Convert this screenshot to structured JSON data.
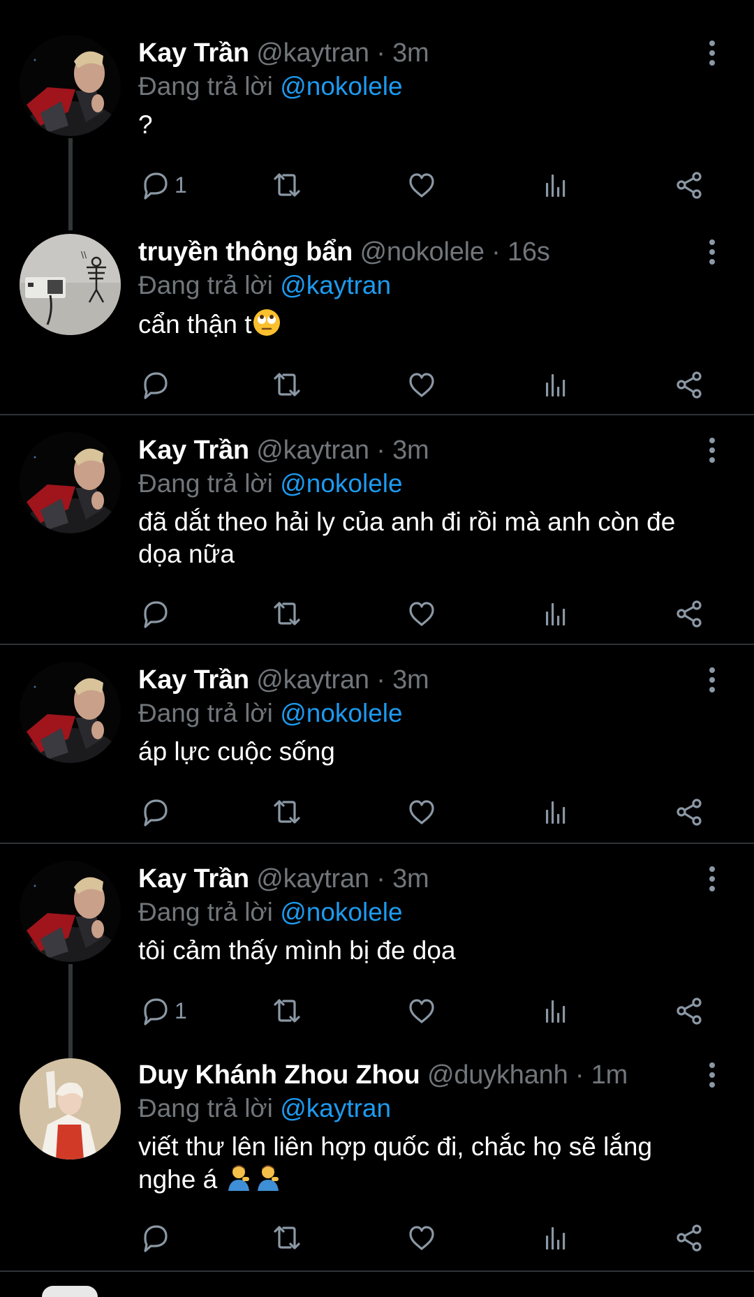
{
  "tweets": [
    {
      "name": "Kay Trần",
      "handle": "@kaytran",
      "time": "3m",
      "reply_prefix": "Đang trả lời",
      "reply_to": "@nokolele",
      "text": "?",
      "reply_count": "1",
      "avatar": "avatar-kaytran"
    },
    {
      "name": "truyền thông bẩn",
      "handle": "@nokolele",
      "time": "16s",
      "reply_prefix": "Đang trả lời",
      "reply_to": "@kaytran",
      "text": "cẩn thận t",
      "emoji": "face-with-rolling-eyes",
      "reply_count": "",
      "avatar": "avatar-nokolele"
    },
    {
      "name": "Kay Trần",
      "handle": "@kaytran",
      "time": "3m",
      "reply_prefix": "Đang trả lời",
      "reply_to": "@nokolele",
      "text_line1": "đã dắt theo hải ly của anh đi rồi mà anh còn đe",
      "text_line2": "dọa nữa",
      "reply_count": "",
      "avatar": "avatar-kaytran"
    },
    {
      "name": "Kay Trần",
      "handle": "@kaytran",
      "time": "3m",
      "reply_prefix": "Đang trả lời",
      "reply_to": "@nokolele",
      "text": "áp lực cuộc sống",
      "reply_count": "",
      "avatar": "avatar-kaytran"
    },
    {
      "name": "Kay Trần",
      "handle": "@kaytran",
      "time": "3m",
      "reply_prefix": "Đang trả lời",
      "reply_to": "@nokolele",
      "text": "tôi cảm thấy mình bị đe dọa",
      "reply_count": "1",
      "avatar": "avatar-kaytran"
    },
    {
      "name": "Duy Khánh Zhou Zhou",
      "handle": "@duykhanh",
      "time": "1m",
      "reply_prefix": "Đang trả lời",
      "reply_to": "@kaytran",
      "text_line1": "viết thư lên liên hợp quốc đi, chắc họ sẽ lắng",
      "text_line2": "nghe á",
      "emoji": "person-tipping-hand x2",
      "reply_count": "",
      "avatar": "avatar-duykhanh"
    }
  ],
  "sep": "·",
  "icons": {
    "reply": "reply-icon",
    "retweet": "retweet-icon",
    "like": "heart-icon",
    "views": "views-icon",
    "share": "share-icon",
    "more": "more-vertical-icon"
  },
  "colors": {
    "background": "#000000",
    "mention": "#1d9bf0",
    "muted": "#71767b",
    "divider": "#2f3336"
  }
}
